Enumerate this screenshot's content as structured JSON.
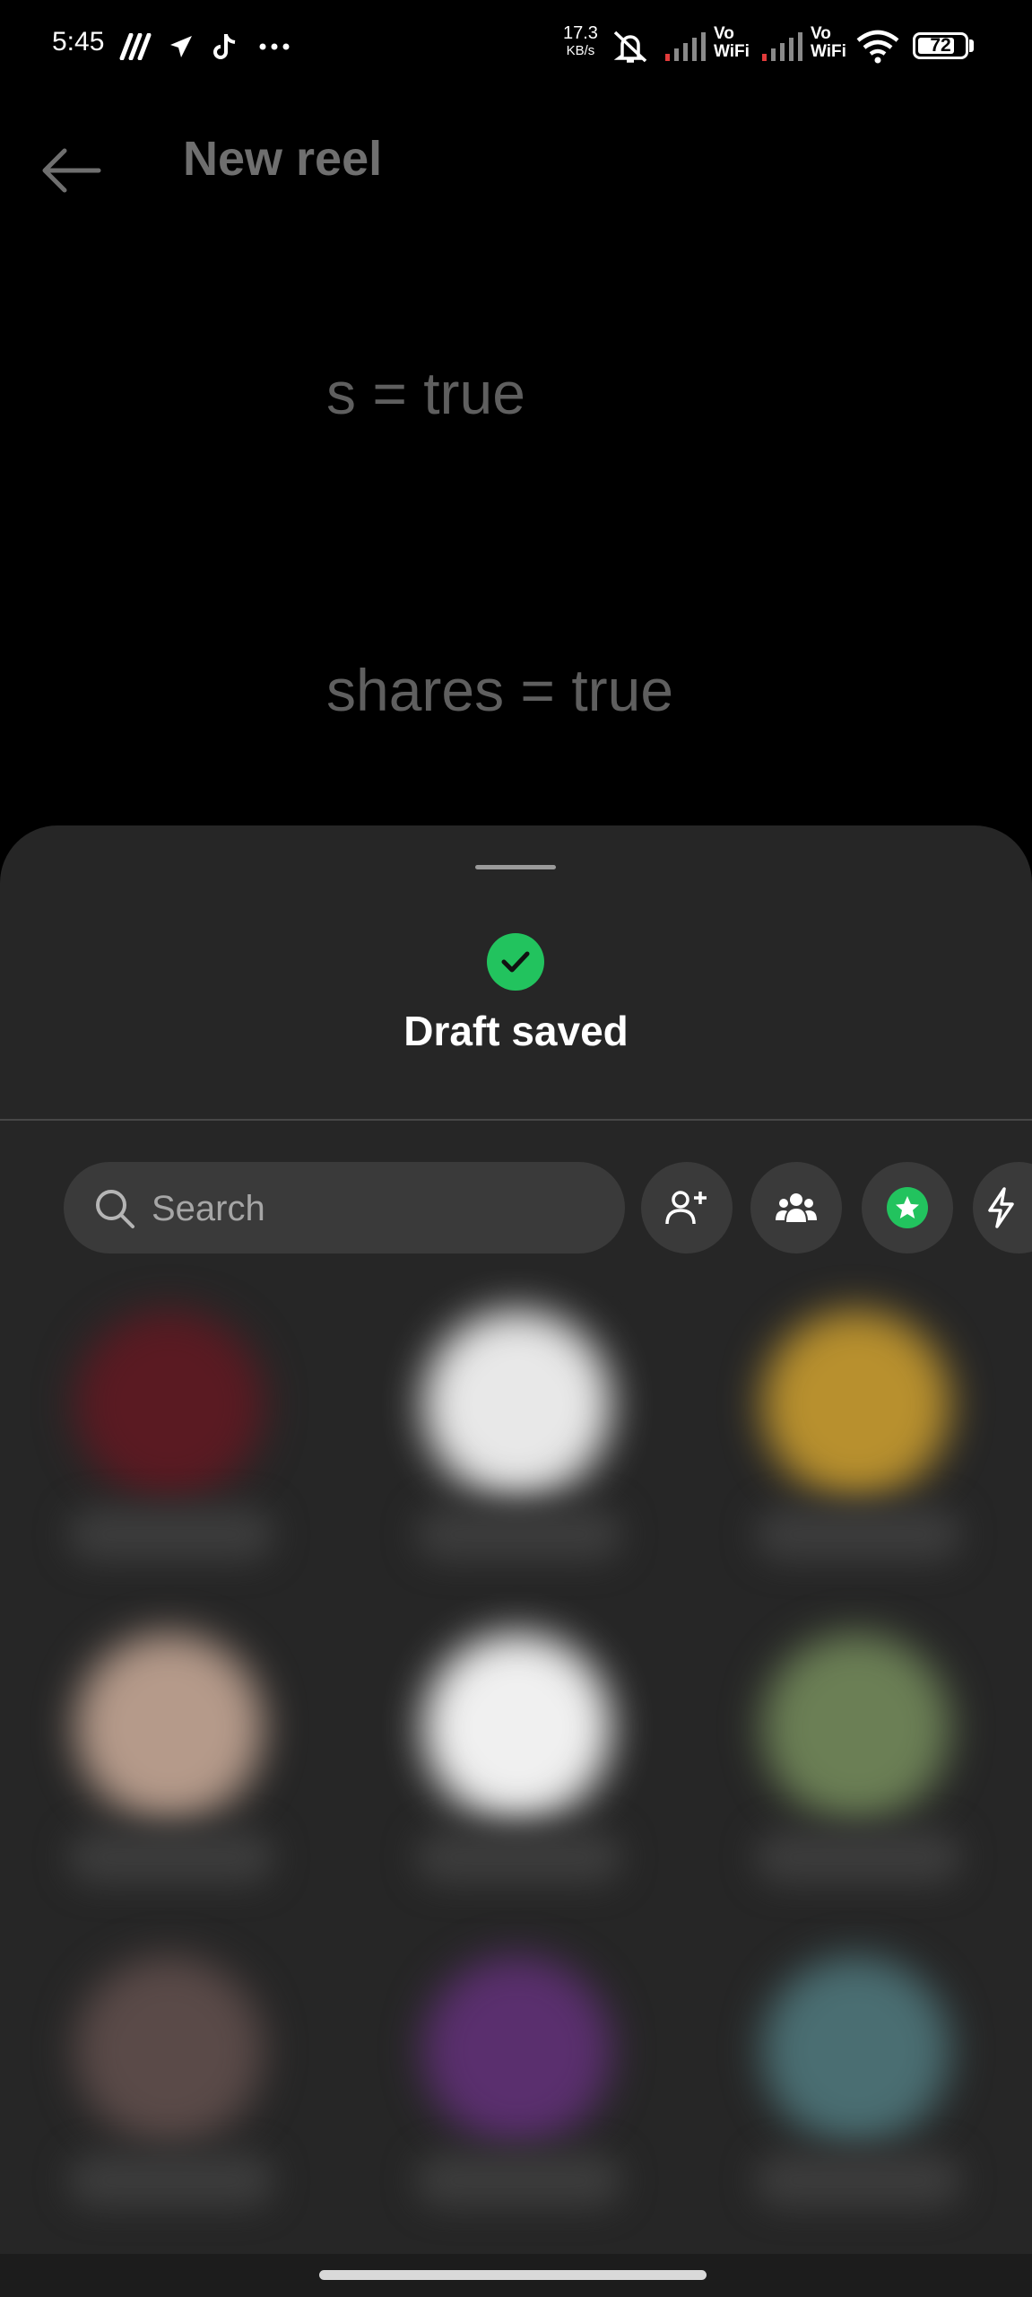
{
  "status_bar": {
    "time": "5:45",
    "net_speed_value": "17.3",
    "net_speed_unit": "KB/s",
    "vowifi_1": [
      "Vo",
      "WiFi"
    ],
    "vowifi_2": [
      "Vo",
      "WiFi"
    ],
    "battery_level": "72"
  },
  "header": {
    "title": "New reel"
  },
  "background_text": {
    "line1": "s = true",
    "line2": "shares = true"
  },
  "sheet": {
    "status_text": "Draft saved",
    "search": {
      "placeholder": "Search",
      "value": ""
    },
    "actions": [
      {
        "icon": "add-person-icon"
      },
      {
        "icon": "group-icon"
      },
      {
        "icon": "close-friends-star-icon"
      },
      {
        "icon": "lightning-icon"
      }
    ],
    "contacts": [
      {
        "name": "",
        "color": "#5a1a22"
      },
      {
        "name": "",
        "color": "#e8e8e8"
      },
      {
        "name": "",
        "color": "#b8902e"
      },
      {
        "name": "",
        "color": "#b59a8a"
      },
      {
        "name": "",
        "color": "#f0f0f0"
      },
      {
        "name": "",
        "color": "#6b7f55"
      },
      {
        "name": "",
        "color": "#5a4a48"
      },
      {
        "name": "",
        "color": "#5a2f6e"
      },
      {
        "name": "",
        "color": "#4a6e72"
      }
    ]
  },
  "colors": {
    "accent_green": "#22c35e",
    "sheet_bg": "#262626",
    "control_bg": "#3a3a3a"
  }
}
